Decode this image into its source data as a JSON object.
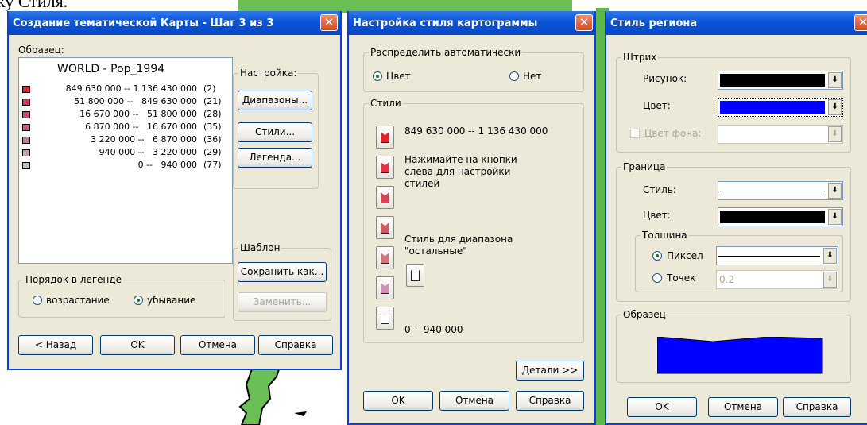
{
  "caption": "ку Стиля.",
  "colors": {
    "title_bar": "#0b54d8",
    "dialog_bg": "#ece9d8",
    "blue_fill": "#0000ff"
  },
  "win1": {
    "title": "Создание тематической Карты - Шаг 3 из 3",
    "sample_label": "Образец:",
    "legend_title": "WORLD - Pop_1994",
    "rows": [
      {
        "range": "849 630 000 -- 1 136 430 000",
        "count": "(2)",
        "color": "#e0222a"
      },
      {
        "range": "51 800 000 --   849 630 000",
        "count": "(21)",
        "color": "#d83454"
      },
      {
        "range": "16 670 000 --   51 800 000",
        "count": "(28)",
        "color": "#cc4a6c"
      },
      {
        "range": "6 870 000 --   16 670 000",
        "count": "(35)",
        "color": "#c06478"
      },
      {
        "range": "3 220 000 --   6 870 000",
        "count": "(36)",
        "color": "#c08090"
      },
      {
        "range": "940 000 --   3 220 000",
        "count": "(29)",
        "color": "#c0a0ac"
      },
      {
        "range": "0 --   940 000",
        "count": "(77)",
        "color": "#c0c0c0"
      }
    ],
    "settings_label": "Настройка:",
    "ranges_btn": "Диапазоны...",
    "styles_btn": "Стили...",
    "legend_btn": "Легенда...",
    "template_label": "Шаблон",
    "save_btn": "Сохранить как...",
    "replace_btn": "Заменить...",
    "order_label": "Порядок в легенде",
    "asc_label": "возрастание",
    "desc_label": "убывание",
    "back_btn": "< Назад",
    "ok_btn": "OK",
    "cancel_btn": "Отмена",
    "help_btn": "Справка"
  },
  "win2": {
    "title": "Настройка стиля картограммы",
    "auto_label": "Распределить автоматически",
    "color_label": "Цвет",
    "none_label": "Нет",
    "styles_label": "Стили",
    "first_range": "849 630 000 -- 1 136 430 000",
    "hint": "Нажимайте на кнопки слева для настройки стилей",
    "others_label": "Стиль для диапазона \"остальные\"",
    "last_range": "0 -- 940 000",
    "style_colors": [
      "#e8202c",
      "#e03448",
      "#d84454",
      "#d45864",
      "#d07878",
      "#d090b4",
      "#ffffff"
    ],
    "details_btn": "Детали >>",
    "ok_btn": "OK",
    "cancel_btn": "Отмена",
    "help_btn": "Справка"
  },
  "win3": {
    "title": "Стиль региона",
    "stroke_label": "Штрих",
    "pattern_label": "Рисунок:",
    "color_label": "Цвет:",
    "bg_color_label": "Цвет фона:",
    "border_label": "Граница",
    "style_label": "Стиль:",
    "border_color_label": "Цвет:",
    "thickness_label": "Толщина",
    "pixel_label": "Пиксел",
    "points_label": "Точек",
    "points_value": "0.2",
    "sample_label": "Образец",
    "ok_btn": "OK",
    "cancel_btn": "Отмена",
    "help_btn": "Справка"
  }
}
